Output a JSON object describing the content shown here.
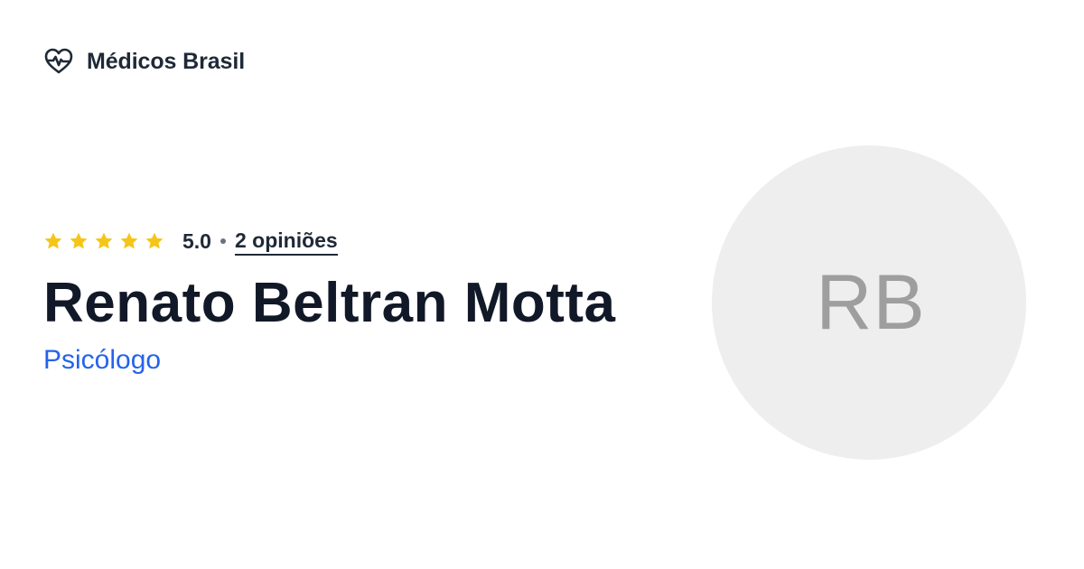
{
  "brand": {
    "name": "Médicos Brasil",
    "icon": "heart-pulse-icon",
    "icon_color": "#1f2937"
  },
  "rating": {
    "stars_filled": 5,
    "stars_total": 5,
    "star_color": "#f5c518",
    "value": "5.0",
    "reviews_label": "2 opiniões"
  },
  "doctor": {
    "name": "Renato Beltran Motta",
    "specialty": "Psicólogo",
    "specialty_color": "#2563eb"
  },
  "avatar": {
    "initials": "RB",
    "background": "#eeeeee",
    "text_color": "#9e9e9e"
  }
}
